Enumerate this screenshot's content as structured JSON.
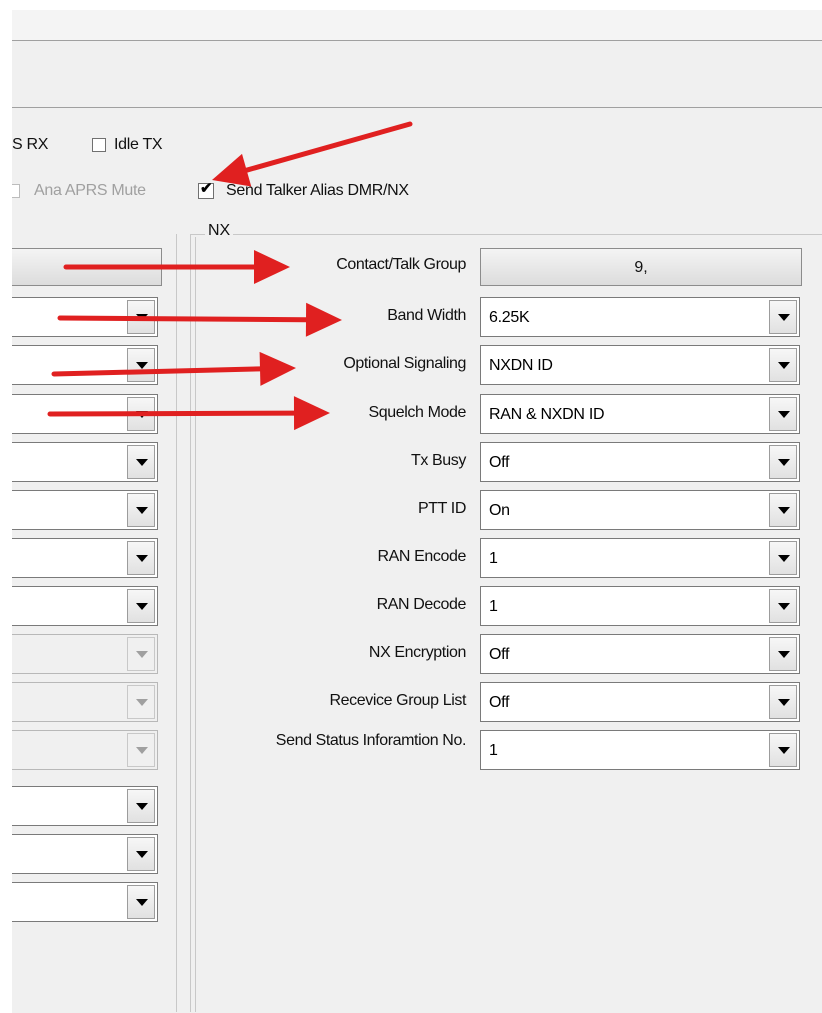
{
  "top_options": {
    "aprs_rx_label": "S RX",
    "idle_tx_label": "Idle TX",
    "ana_aprs_mute_label": "Ana APRS Mute",
    "send_talker_alias_label": "Send Talker Alias DMR/NX",
    "send_talker_alias_checked": true,
    "idle_tx_checked": false,
    "ana_aprs_mute_checked": false
  },
  "nx_group": {
    "title": "NX",
    "contact_talk_group": {
      "label": "Contact/Talk Group",
      "value": "9,"
    },
    "fields": [
      {
        "label": "Band Width",
        "value": "6.25K"
      },
      {
        "label": "Optional Signaling",
        "value": "NXDN ID"
      },
      {
        "label": "Squelch Mode",
        "value": "RAN & NXDN ID"
      },
      {
        "label": "Tx Busy",
        "value": "Off"
      },
      {
        "label": "PTT ID",
        "value": "On"
      },
      {
        "label": "RAN Encode",
        "value": "1"
      },
      {
        "label": "RAN Decode",
        "value": "1"
      },
      {
        "label": "NX Encryption",
        "value": "Off"
      },
      {
        "label": "Recevice Group List",
        "value": "Off"
      },
      {
        "label": "Send Status Inforamtion No.",
        "value": "1"
      }
    ]
  },
  "left_column": {
    "dropdowns": [
      {
        "state": "enabled"
      },
      {
        "state": "enabled"
      },
      {
        "state": "enabled"
      },
      {
        "state": "enabled"
      },
      {
        "state": "enabled"
      },
      {
        "state": "enabled"
      },
      {
        "state": "enabled"
      },
      {
        "state": "disabled"
      },
      {
        "state": "disabled"
      },
      {
        "state": "disabled"
      },
      {
        "state": "enabled"
      },
      {
        "state": "enabled"
      },
      {
        "state": "enabled"
      },
      {
        "state": "enabled"
      }
    ]
  },
  "annotation_color": "#e02020"
}
